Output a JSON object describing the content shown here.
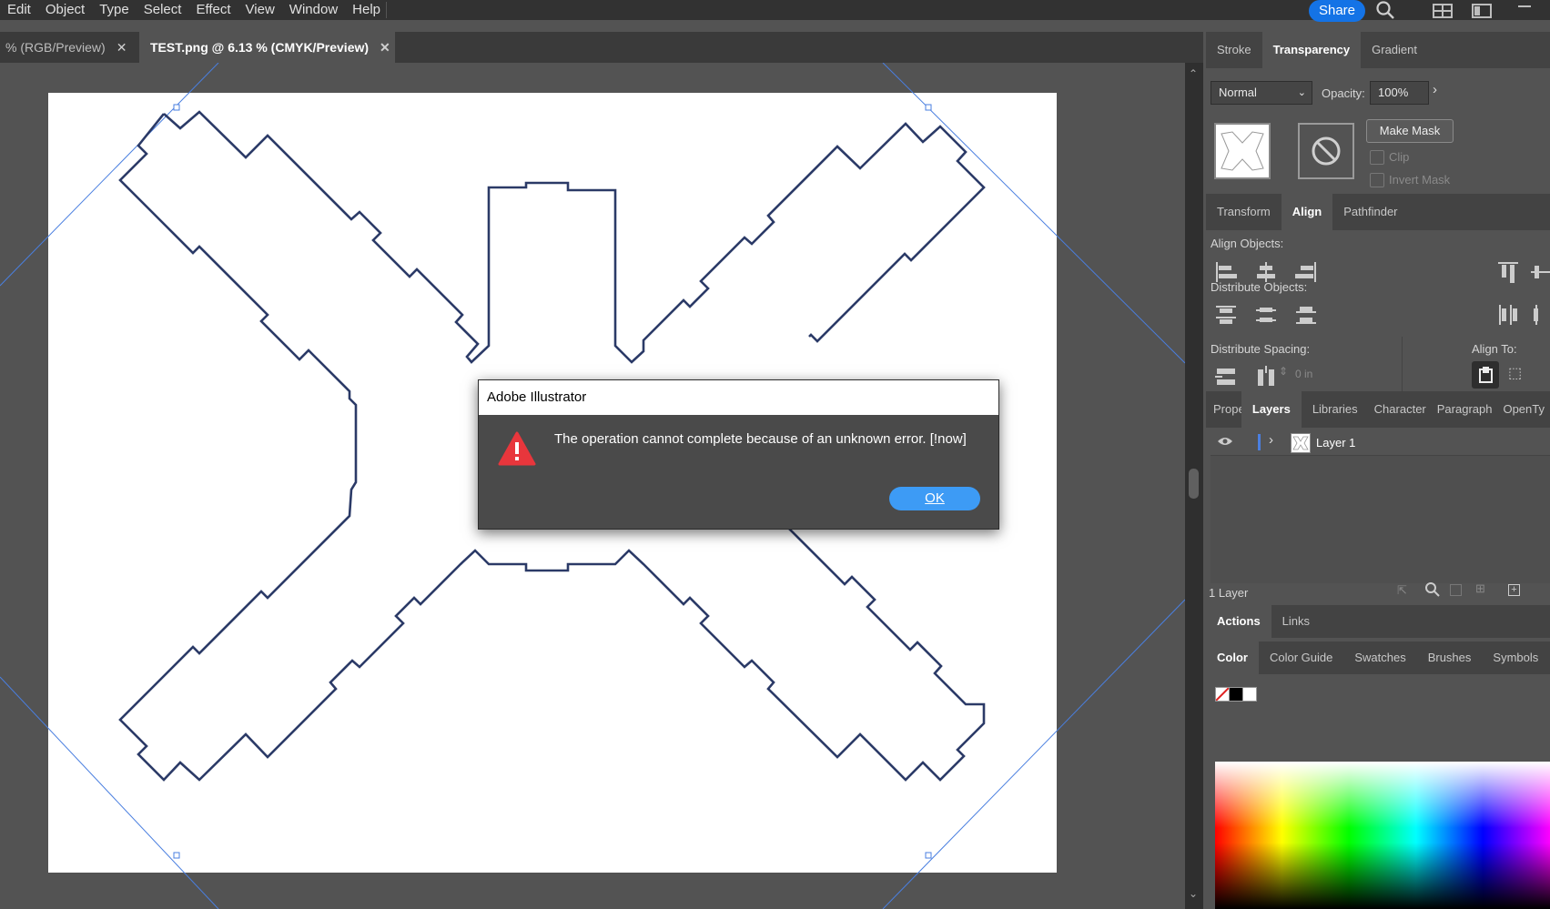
{
  "menu": [
    "Edit",
    "Object",
    "Type",
    "Select",
    "Effect",
    "View",
    "Window",
    "Help"
  ],
  "top_right": {
    "share_label": "Share"
  },
  "doc_tabs": [
    {
      "label": "% (RGB/Preview)",
      "active": false
    },
    {
      "label": "TEST.png @ 6.13 % (CMYK/Preview)",
      "active": true
    }
  ],
  "transparency_panel": {
    "tabs": [
      "Stroke",
      "Transparency",
      "Gradient"
    ],
    "blend_mode": "Normal",
    "opacity_label": "Opacity:",
    "opacity_value": "100%",
    "make_mask_label": "Make Mask",
    "clip_label": "Clip",
    "invert_mask_label": "Invert Mask"
  },
  "align_panel": {
    "tabs": [
      "Transform",
      "Align",
      "Pathfinder"
    ],
    "align_objects_label": "Align Objects:",
    "distribute_objects_label": "Distribute Objects:",
    "distribute_spacing_label": "Distribute Spacing:",
    "spacing_value": "0 in",
    "align_to_label": "Align To:"
  },
  "layers_panel": {
    "tabs": [
      "Propertie:",
      "Layers",
      "Libraries",
      "Character",
      "Paragraph",
      "OpenTy"
    ],
    "layers": [
      {
        "name": "Layer 1",
        "visible": true
      }
    ],
    "footer_count": "1 Layer"
  },
  "actions_panel": {
    "tabs": [
      "Actions",
      "Links"
    ]
  },
  "color_panel": {
    "tabs": [
      "Color",
      "Color Guide",
      "Swatches",
      "Brushes",
      "Symbols"
    ]
  },
  "dialog": {
    "title": "Adobe Illustrator",
    "message": "The operation cannot complete because of an unknown error.   [!now]",
    "ok_label": "OK"
  },
  "colors": {
    "accent": "#1473e6",
    "ok_button": "#3d9bf5",
    "path_stroke": "#2b3a67",
    "guide": "#4a7fe0"
  }
}
